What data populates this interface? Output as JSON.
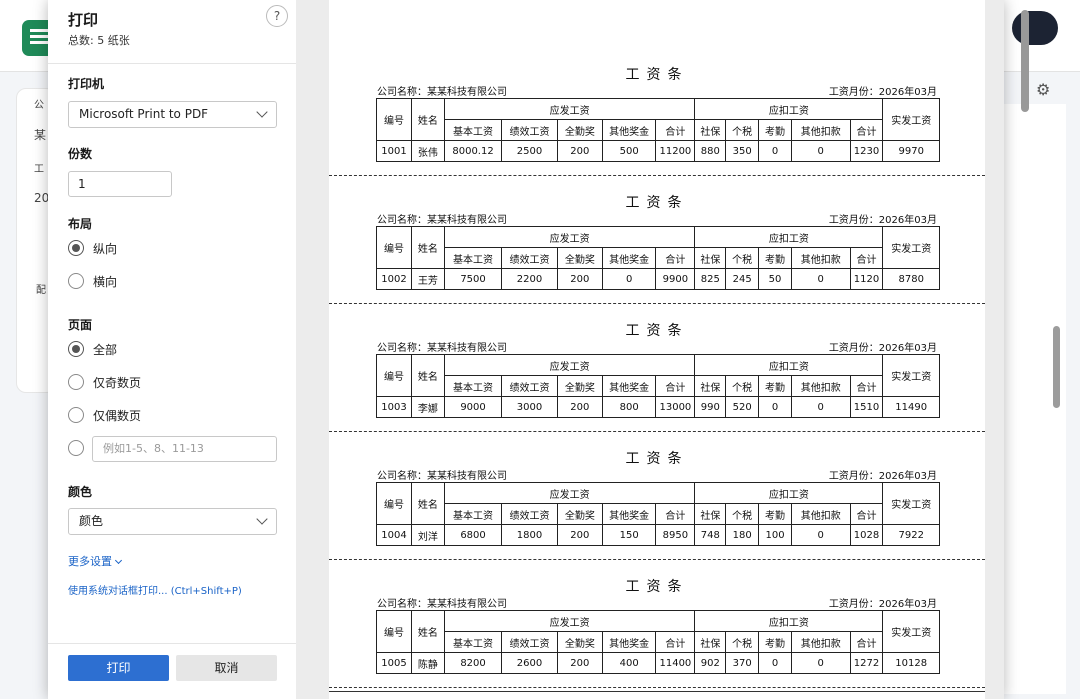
{
  "dialog": {
    "title": "打印",
    "count_text": "总数: 5 纸张",
    "help_glyph": "?"
  },
  "printer": {
    "label": "打印机",
    "selected": "Microsoft Print to PDF"
  },
  "copies": {
    "label": "份数",
    "value": "1"
  },
  "layout": {
    "label": "布局",
    "options": [
      "纵向",
      "横向"
    ],
    "selected_index": 0
  },
  "pages": {
    "label": "页面",
    "options": [
      "全部",
      "仅奇数页",
      "仅偶数页"
    ],
    "selected_index": 0,
    "custom_placeholder": "例如1-5、8、11-13"
  },
  "color": {
    "label": "颜色",
    "selected": "颜色"
  },
  "more_settings": "更多设置",
  "system_dialog_link": "使用系统对话框打印... (Ctrl+Shift+P)",
  "buttons": {
    "print": "打印",
    "cancel": "取消"
  },
  "slip_header": {
    "title": "工资条",
    "company": "公司名称：某某科技有限公司",
    "month": "工资月份：2026年03月",
    "col_id": "编号",
    "col_name": "姓名",
    "group_payable": "应发工资",
    "group_deduct": "应扣工资",
    "col_net": "实发工资",
    "payable_cols": [
      "基本工资",
      "绩效工资",
      "全勤奖",
      "其他奖金",
      "合计"
    ],
    "deduct_cols": [
      "社保",
      "个税",
      "考勤",
      "其他扣款",
      "合计"
    ]
  },
  "slips": [
    {
      "id": "1001",
      "name": "张伟",
      "base": "8000.12",
      "perf": "2500",
      "attend_bonus": "200",
      "other_bonus": "500",
      "pay_total": "11200",
      "social": "880",
      "tax": "350",
      "attend_deduct": "0",
      "other_deduct": "0",
      "deduct_total": "1230",
      "net": "9970"
    },
    {
      "id": "1002",
      "name": "王芳",
      "base": "7500",
      "perf": "2200",
      "attend_bonus": "200",
      "other_bonus": "0",
      "pay_total": "9900",
      "social": "825",
      "tax": "245",
      "attend_deduct": "50",
      "other_deduct": "0",
      "deduct_total": "1120",
      "net": "8780"
    },
    {
      "id": "1003",
      "name": "李娜",
      "base": "9000",
      "perf": "3000",
      "attend_bonus": "200",
      "other_bonus": "800",
      "pay_total": "13000",
      "social": "990",
      "tax": "520",
      "attend_deduct": "0",
      "other_deduct": "0",
      "deduct_total": "1510",
      "net": "11490"
    },
    {
      "id": "1004",
      "name": "刘洋",
      "base": "6800",
      "perf": "1800",
      "attend_bonus": "200",
      "other_bonus": "150",
      "pay_total": "8950",
      "social": "748",
      "tax": "180",
      "attend_deduct": "100",
      "other_deduct": "0",
      "deduct_total": "1028",
      "net": "7922"
    },
    {
      "id": "1005",
      "name": "陈静",
      "base": "8200",
      "perf": "2600",
      "attend_bonus": "200",
      "other_bonus": "400",
      "pay_total": "11400",
      "social": "902",
      "tax": "370",
      "attend_deduct": "0",
      "other_deduct": "0",
      "deduct_total": "1272",
      "net": "10128"
    }
  ],
  "background": {
    "sidebar_texts": [
      "公",
      "某",
      "工",
      "20",
      "配"
    ]
  },
  "colors": {
    "accent": "#2d6fd1",
    "link": "#1a63c7"
  }
}
